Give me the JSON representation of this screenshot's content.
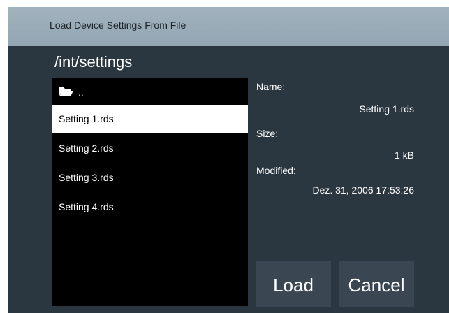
{
  "dialog": {
    "title": "Load Device Settings From File",
    "path": "/int/settings"
  },
  "files": {
    "parent_label": "..",
    "items": [
      {
        "name": "Setting 1.rds",
        "selected": true
      },
      {
        "name": "Setting 2.rds",
        "selected": false
      },
      {
        "name": "Setting 3.rds",
        "selected": false
      },
      {
        "name": "Setting 4.rds",
        "selected": false
      }
    ]
  },
  "details": {
    "name_label": "Name:",
    "name_value": "Setting 1.rds",
    "size_label": "Size:",
    "size_value": "1 kB",
    "modified_label": "Modified:",
    "modified_value": "Dez. 31, 2006 17:53:26"
  },
  "buttons": {
    "load_label": "Load",
    "cancel_label": "Cancel"
  },
  "icons": {
    "parent_folder": "open-folder-icon"
  },
  "colors": {
    "titlebar": "#9aabb8",
    "dialog_bg": "#2a3640",
    "list_bg": "#000000",
    "selected_bg": "#ffffff",
    "button_bg": "#3a4753"
  }
}
